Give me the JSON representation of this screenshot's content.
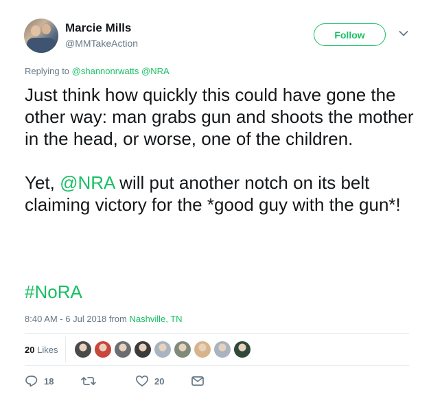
{
  "author": {
    "name": "Marcie Mills",
    "handle": "@MMTakeAction",
    "follow_label": "Follow"
  },
  "reply": {
    "prefix": "Replying to",
    "mentions": [
      "@shannonrwatts",
      "@NRA"
    ]
  },
  "tweet": {
    "paragraph1": "Just think how quickly this could have gone the other way: man grabs gun and shoots the mother in the head, or worse, one of the children.",
    "paragraph2_before": "Yet, ",
    "paragraph2_mention": "@NRA",
    "paragraph2_after": " will put another notch on its belt claiming victory for the *good guy with the gun*!",
    "hashtag": "#NoRA"
  },
  "meta": {
    "time": "8:40 AM - 6 Jul 2018 from ",
    "location": "Nashville, TN"
  },
  "stats": {
    "likes_count": "20",
    "likes_label": "Likes",
    "liker_avatars": [
      "#4a4a4a",
      "#c8463c",
      "#6a6e73",
      "#3b3b3b",
      "#a8b4bf",
      "#7f8a7a",
      "#d8b48a",
      "#a8b4bf",
      "#2f4a3a"
    ]
  },
  "actions": {
    "reply_count": "18",
    "retweet_count": "",
    "like_count": "20"
  },
  "colors": {
    "accent": "#17bf63",
    "muted": "#657786",
    "text": "#14171a"
  }
}
